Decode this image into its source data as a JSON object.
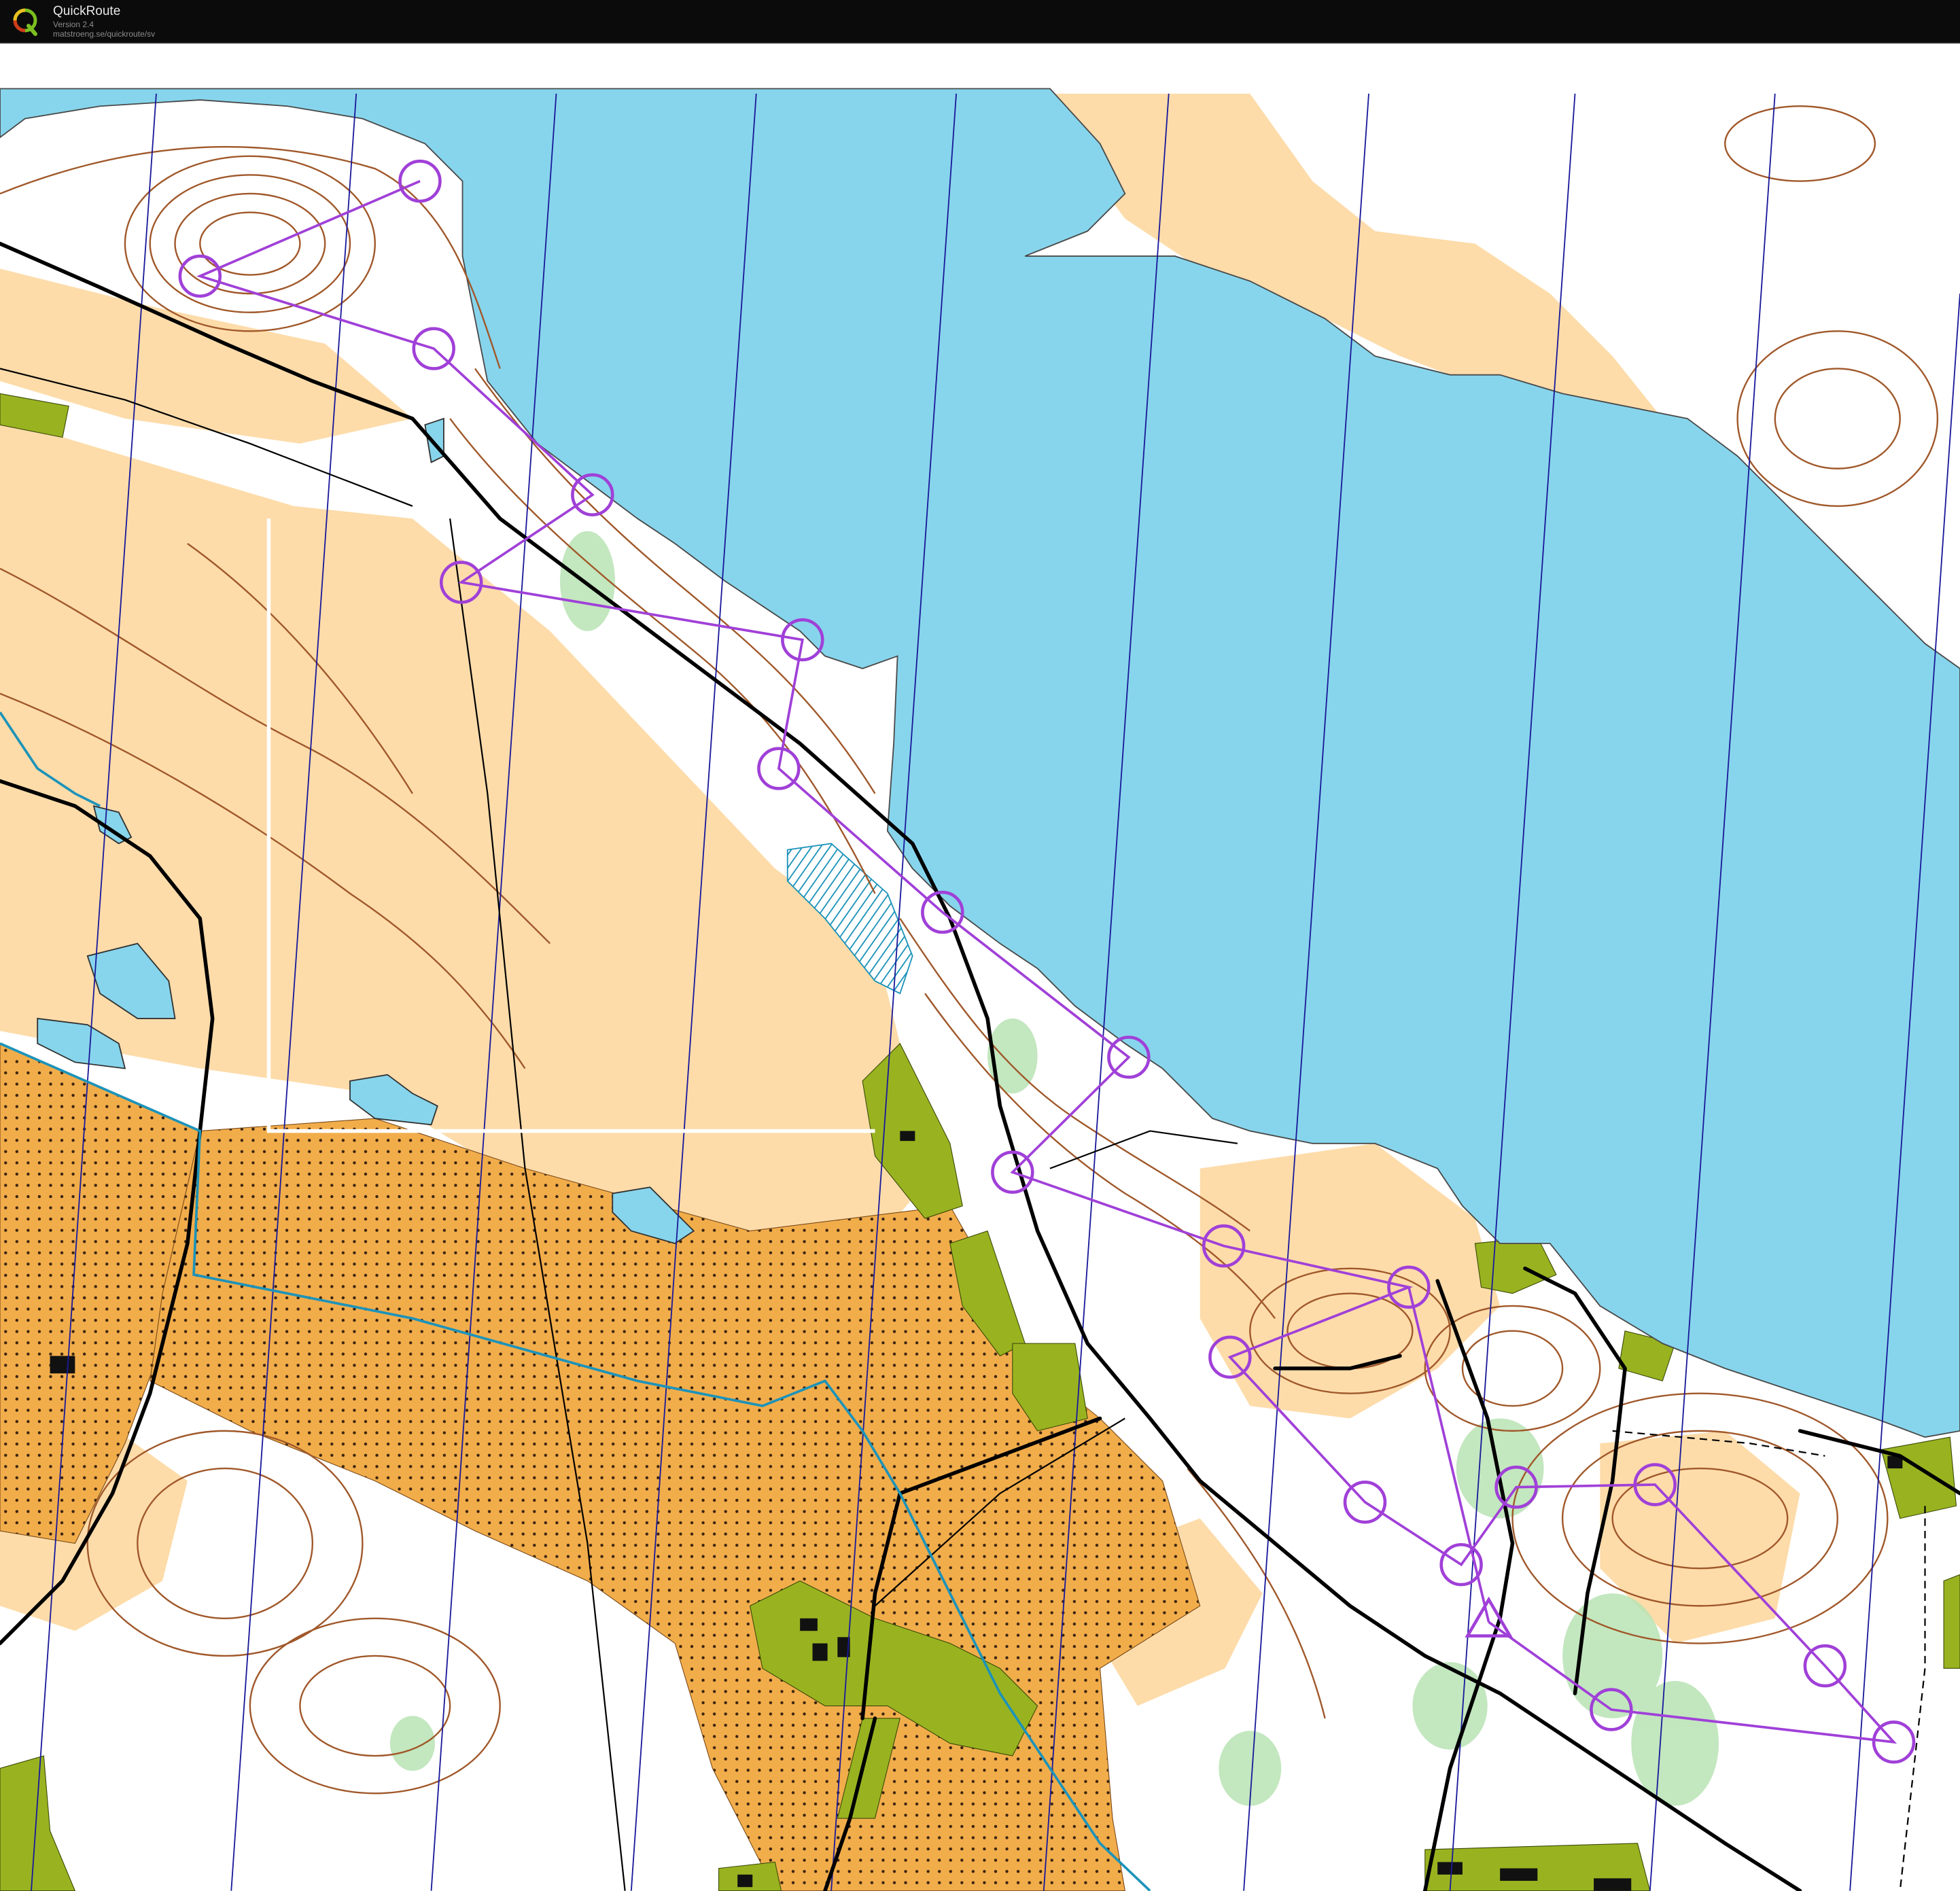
{
  "app": {
    "name": "QuickRoute",
    "version": "Version 2.4",
    "url": "matstroeng.se/quickroute/sv"
  },
  "map": {
    "kind": "orienteering map",
    "colors": {
      "water": "#87d5ec",
      "open_land": "#fddcaa",
      "field": "#f2ad4b",
      "settlement": "#99b320",
      "contour": "#a0582a",
      "course": "#a040d8",
      "magnetic_north": "#1a1a9a",
      "road": "#000000",
      "stream": "#1d93b9",
      "vegetation": "#b8e3b4"
    },
    "course": {
      "color": "#a040d8",
      "start_symbol": "triangle",
      "control_symbol": "circle",
      "controls_count": 21
    },
    "background_features": [
      "lake",
      "open-land",
      "field",
      "settlement",
      "contours",
      "roads",
      "streams",
      "meridians"
    ]
  }
}
